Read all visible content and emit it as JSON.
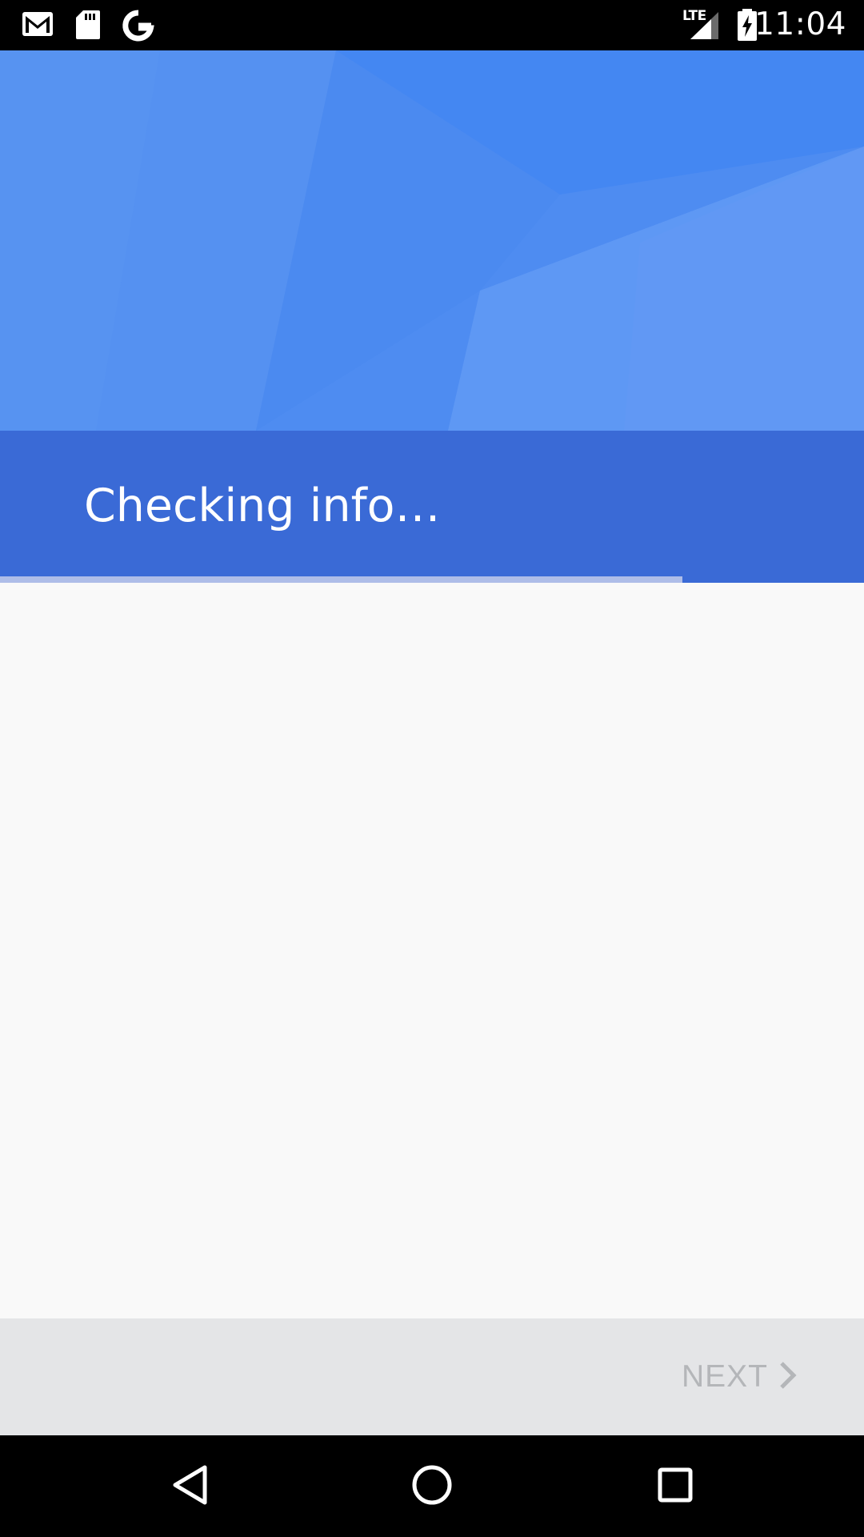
{
  "status_bar": {
    "time": "11:04",
    "network_label": "LTE",
    "notification_icons": [
      "gmail-icon",
      "sd-card-icon",
      "google-icon"
    ],
    "system_icons": [
      "signal-icon",
      "battery-charging-icon"
    ]
  },
  "header": {
    "title": "Checking info…",
    "progress_fraction": 0.79,
    "colors": {
      "hero": "#4f8cf0",
      "band": "#3a6ad6",
      "progress_track": "#aebde8"
    }
  },
  "footer": {
    "next_label": "NEXT",
    "next_icon": "chevron-right-icon",
    "next_enabled": false
  },
  "nav_bar": {
    "buttons": [
      "back-icon",
      "home-icon",
      "recents-icon"
    ]
  }
}
